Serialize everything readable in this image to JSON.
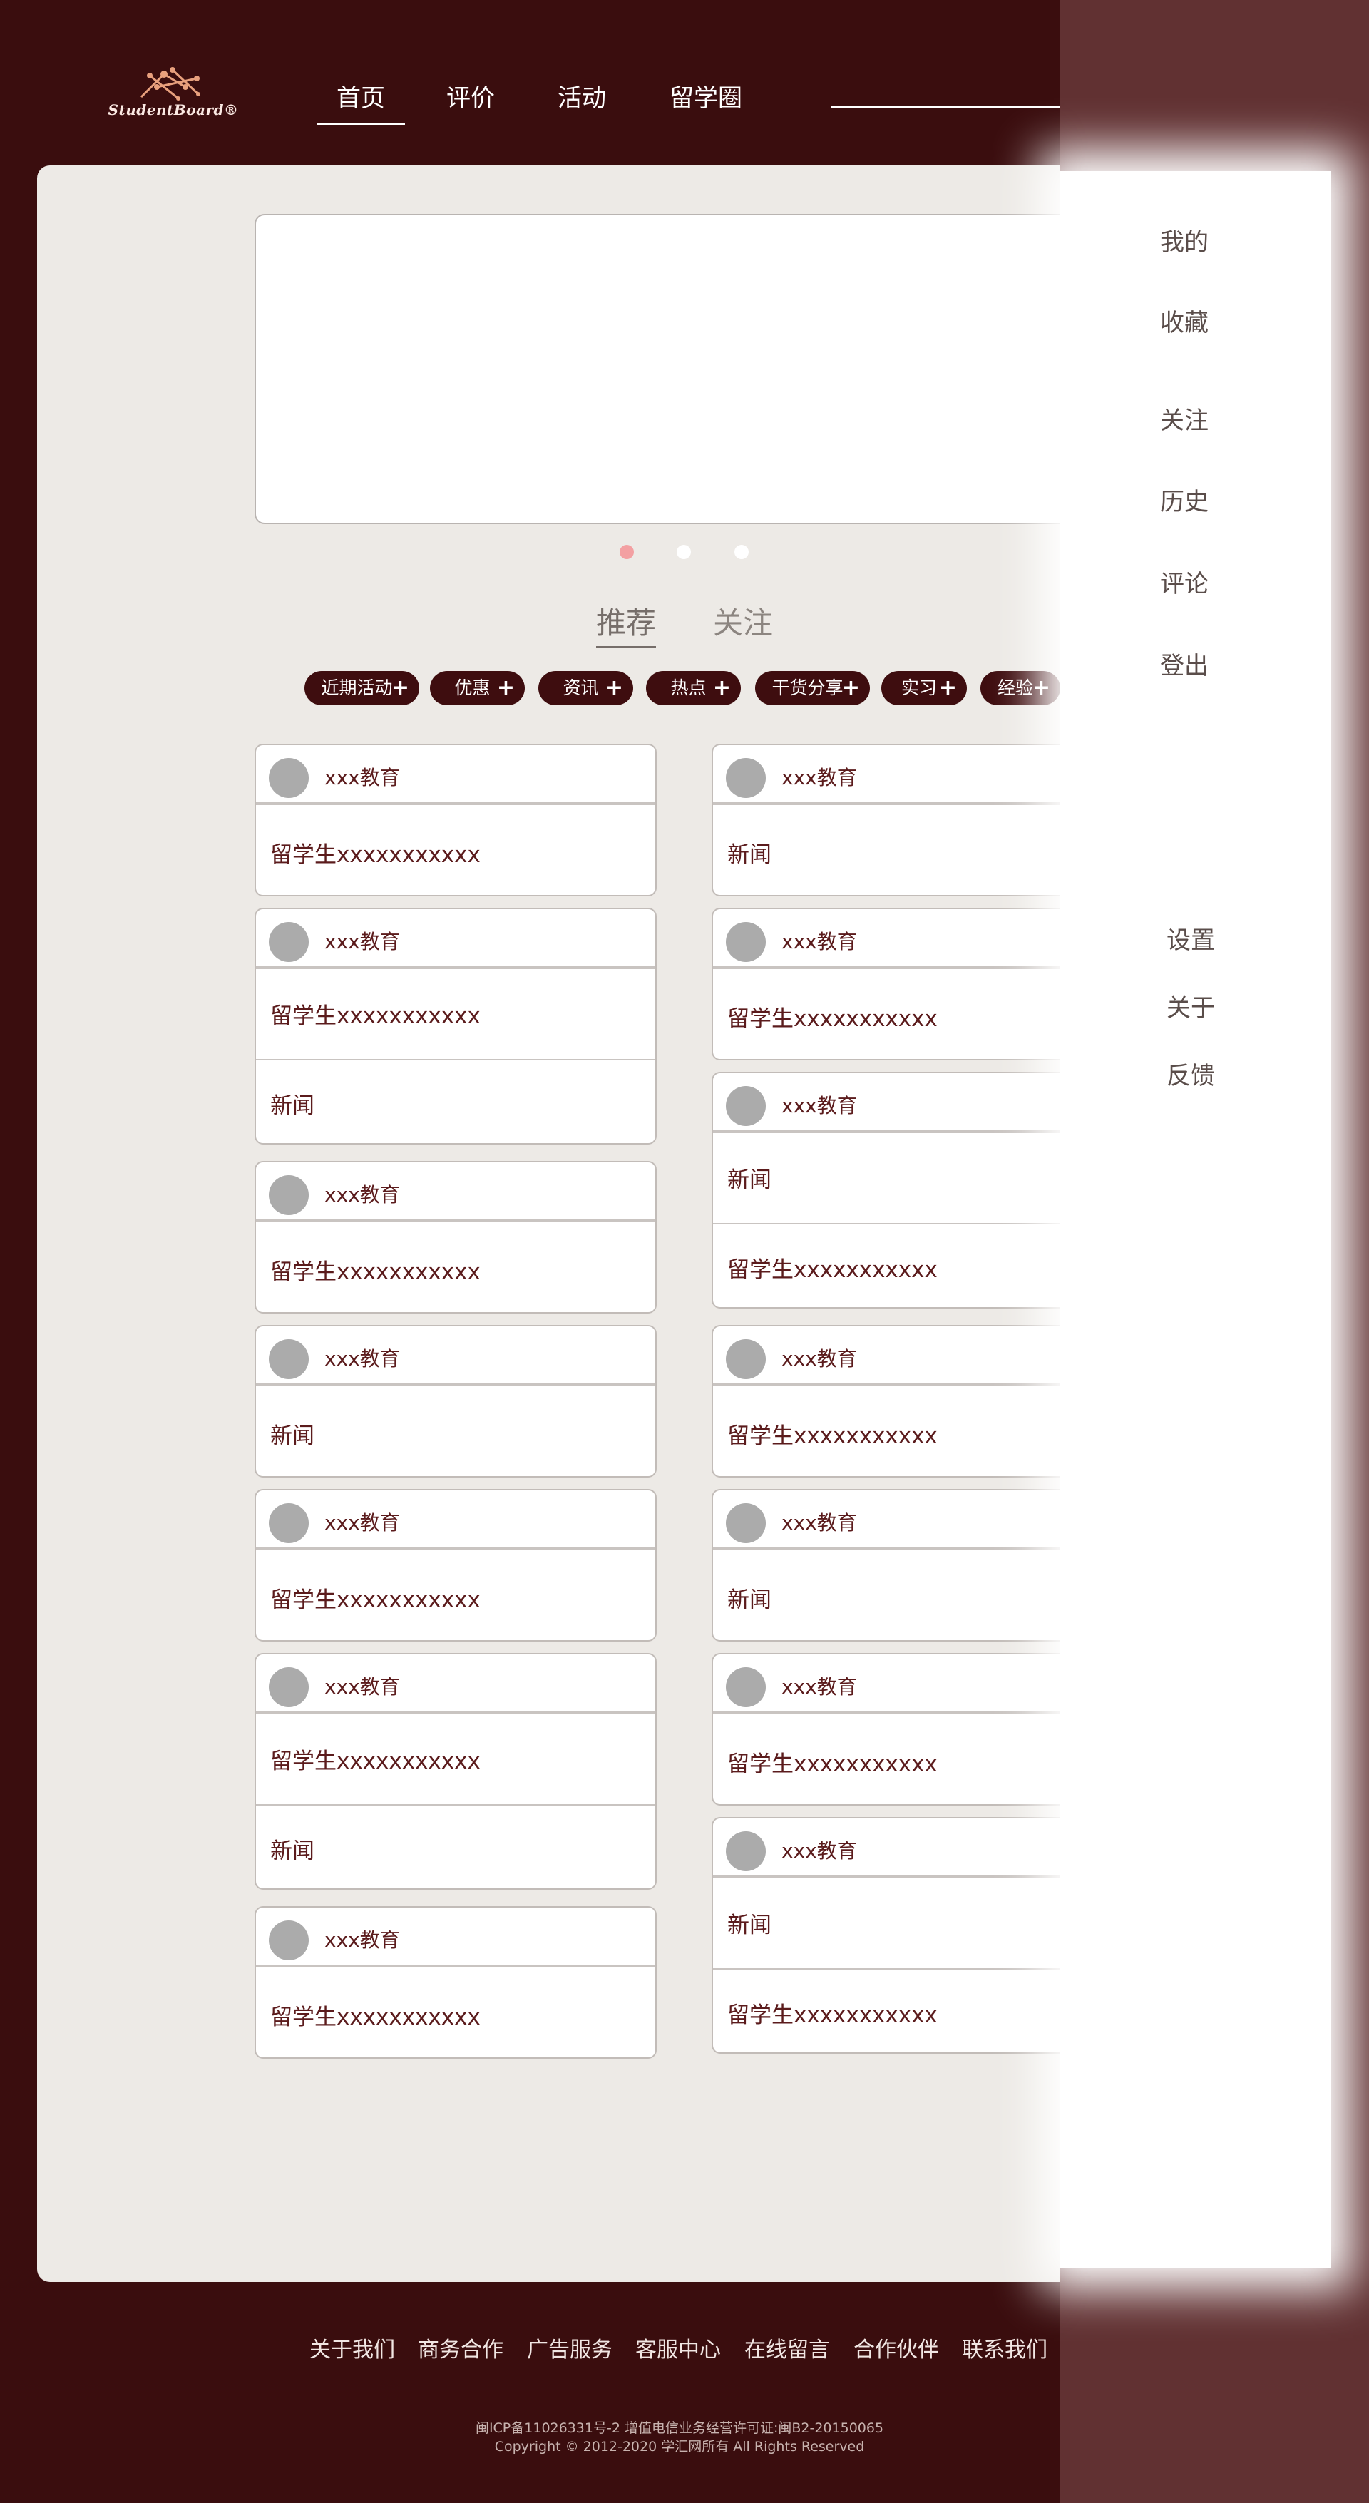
{
  "brand": {
    "logo_text": "StudentBoard®"
  },
  "nav": [
    {
      "label": "首页",
      "active": true
    },
    {
      "label": "评价"
    },
    {
      "label": "活动"
    },
    {
      "label": "留学圈"
    }
  ],
  "feed_tabs": [
    {
      "label": "推荐",
      "active": true
    },
    {
      "label": "关注"
    }
  ],
  "carousel": {
    "count": 3,
    "active_index": 0
  },
  "chips": [
    {
      "label": "近期活动"
    },
    {
      "label": "优惠"
    },
    {
      "label": "资讯"
    },
    {
      "label": "热点"
    },
    {
      "label": "干货分享"
    },
    {
      "label": "实习"
    },
    {
      "label": "经验"
    }
  ],
  "chip_icon": "+",
  "feed": {
    "left": [
      {
        "source": "xxx教育",
        "items": [
          "留学生xxxxxxxxxxx"
        ]
      },
      {
        "source": "xxx教育",
        "items": [
          "留学生xxxxxxxxxxx",
          "新闻"
        ]
      },
      {
        "source": "xxx教育",
        "items": [
          "留学生xxxxxxxxxxx"
        ]
      },
      {
        "source": "xxx教育",
        "items": [
          "新闻"
        ]
      },
      {
        "source": "xxx教育",
        "items": [
          "留学生xxxxxxxxxxx"
        ]
      },
      {
        "source": "xxx教育",
        "items": [
          "留学生xxxxxxxxxxx",
          "新闻"
        ]
      },
      {
        "source": "xxx教育",
        "items": [
          "留学生xxxxxxxxxxx"
        ]
      }
    ],
    "right": [
      {
        "source": "xxx教育",
        "items": [
          "新闻"
        ]
      },
      {
        "source": "xxx教育",
        "items": [
          "留学生xxxxxxxxxxx"
        ]
      },
      {
        "source": "xxx教育",
        "items": [
          "新闻",
          "留学生xxxxxxxxxxx"
        ]
      },
      {
        "source": "xxx教育",
        "items": [
          "留学生xxxxxxxxxxx"
        ]
      },
      {
        "source": "xxx教育",
        "items": [
          "新闻"
        ]
      },
      {
        "source": "xxx教育",
        "items": [
          "留学生xxxxxxxxxxx"
        ]
      },
      {
        "source": "xxx教育",
        "items": [
          "新闻",
          "留学生xxxxxxxxxxx"
        ]
      }
    ]
  },
  "footer": {
    "links": [
      "关于我们",
      "商务合作",
      "广告服务",
      "客服中心",
      "在线留言",
      "合作伙伴",
      "联系我们"
    ],
    "icp_line": "闽ICP备11026331号-2 增值电信业务经营许可证:闽B2-20150065",
    "copyright": "Copyright © 2012-2020 学汇网所有 All Rights Reserved"
  },
  "side_menu": {
    "top": [
      "我的",
      "收藏",
      "关注",
      "历史",
      "评论",
      "登出"
    ],
    "bottom": [
      "设置",
      "关于",
      "反馈"
    ]
  },
  "colors": {
    "background": "#3a0d0e",
    "panel": "#edeae6",
    "chip": "#3e0d0f",
    "accent_dot": "#f3a0a2",
    "text_dark_red": "#5b1b1c"
  }
}
